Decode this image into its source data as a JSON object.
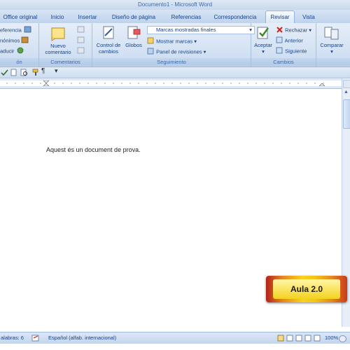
{
  "window": {
    "title": "Documento1 - Microsoft Word"
  },
  "tabs": [
    {
      "label": "Office original"
    },
    {
      "label": "Inicio"
    },
    {
      "label": "Insertar"
    },
    {
      "label": "Diseño de página"
    },
    {
      "label": "Referencias"
    },
    {
      "label": "Correspondencia"
    },
    {
      "label": "Revisar"
    },
    {
      "label": "Vista"
    }
  ],
  "ribbon": {
    "revision_group": {
      "items": [
        "eferencia",
        "nónimos",
        "aducir"
      ],
      "label": "ón"
    },
    "comments_group": {
      "new_comment": "Nuevo comentario",
      "label": "Comentarios"
    },
    "tracking_group": {
      "track_changes": "Control de cambios",
      "balloons": "Globos",
      "markup_select": "Marcas mostradas finales",
      "show_markup": "Mostrar marcas",
      "review_pane": "Panel de revisiones",
      "label": "Seguimiento"
    },
    "changes_group": {
      "accept": "Aceptar",
      "reject": "Rechazar",
      "previous": "Anterior",
      "next": "Siguiente",
      "label": "Cambios"
    },
    "compare_group": {
      "compare": "Comparar"
    }
  },
  "document": {
    "text": "Aquest és un document de prova."
  },
  "status": {
    "words": "alabras: 6",
    "language": "Español (alfab. internacional)",
    "zoom": "100%"
  },
  "logo": {
    "text": "Aula 2.0"
  }
}
